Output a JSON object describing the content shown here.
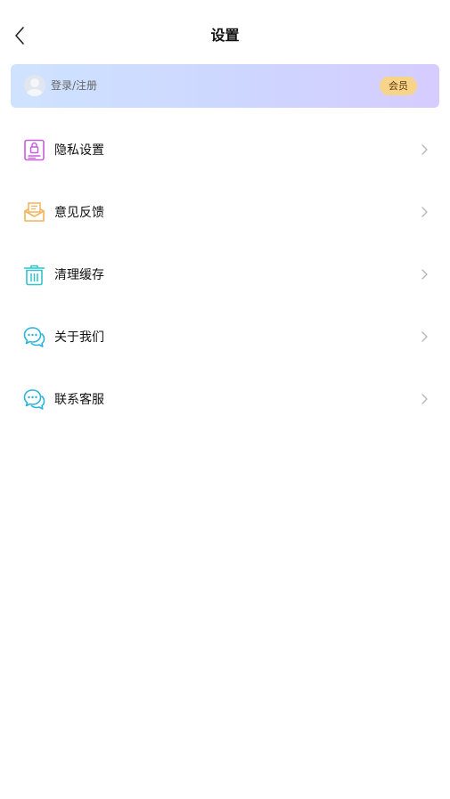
{
  "header": {
    "title": "设置",
    "back_icon": "chevron-left-icon"
  },
  "account": {
    "login_label": "登录/注册",
    "badge_label": "会员",
    "avatar_icon": "avatar-placeholder-icon"
  },
  "menu": [
    {
      "label": "隐私设置",
      "icon": "privacy-lock-icon",
      "color": "#c65fd8"
    },
    {
      "label": "意见反馈",
      "icon": "feedback-envelope-icon",
      "color": "#f3b35a"
    },
    {
      "label": "清理缓存",
      "icon": "trash-can-icon",
      "color": "#31c4c8"
    },
    {
      "label": "关于我们",
      "icon": "chat-bubbles-icon",
      "color": "#2bb3d8"
    },
    {
      "label": "联系客服",
      "icon": "chat-bubbles-icon",
      "color": "#2bb3d8"
    }
  ],
  "colors": {
    "card_gradient_start": "#cfe3ff",
    "card_gradient_end": "#d6ccff",
    "badge_bg": "#f8d48a",
    "chevron": "#b5b5b5"
  }
}
